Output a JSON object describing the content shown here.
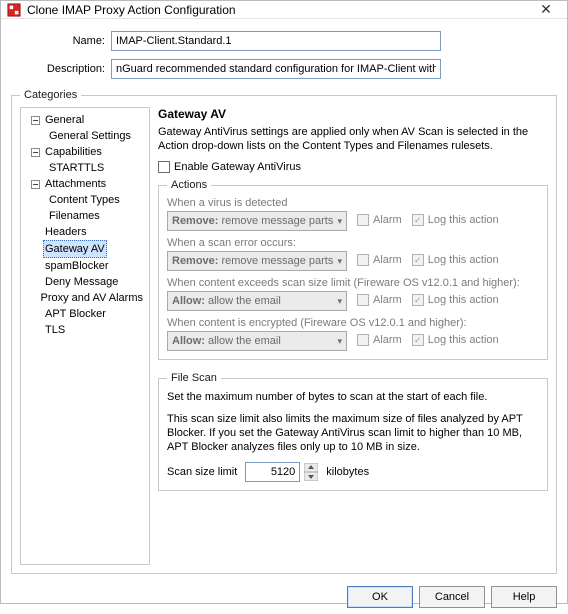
{
  "window": {
    "title": "Clone IMAP Proxy Action Configuration"
  },
  "form": {
    "name_label": "Name:",
    "name_value": "IMAP-Client.Standard.1",
    "desc_label": "Description:",
    "desc_value": "nGuard recommended standard configuration for IMAP-Client with logging enabled"
  },
  "categories": {
    "legend": "Categories",
    "tree": {
      "general": "General",
      "general_settings": "General Settings",
      "capabilities": "Capabilities",
      "starttls": "STARTTLS",
      "attachments": "Attachments",
      "content_types": "Content Types",
      "filenames": "Filenames",
      "headers": "Headers",
      "gateway_av": "Gateway AV",
      "spamblocker": "spamBlocker",
      "deny_message": "Deny Message",
      "proxy_av_alarms": "Proxy and AV Alarms",
      "apt_blocker": "APT Blocker",
      "tls": "TLS"
    }
  },
  "gateway": {
    "title": "Gateway AV",
    "description": "Gateway AntiVirus settings are applied only when AV Scan is selected in the Action drop-down lists on the Content Types and Filenames rulesets.",
    "enable_label": "Enable Gateway AntiVirus"
  },
  "actions": {
    "legend": "Actions",
    "alarm_label": "Alarm",
    "log_label": "Log this action",
    "rows": [
      {
        "label": "When a virus is detected",
        "combo_main": "Remove:",
        "combo_sub": "remove message parts"
      },
      {
        "label": "When a scan error occurs:",
        "combo_main": "Remove:",
        "combo_sub": "remove message parts"
      },
      {
        "label": "When content exceeds scan size limit (Fireware OS v12.0.1 and higher):",
        "combo_main": "Allow:",
        "combo_sub": "allow the email"
      },
      {
        "label": "When content is encrypted (Fireware OS v12.0.1 and higher):",
        "combo_main": "Allow:",
        "combo_sub": "allow the email"
      }
    ]
  },
  "filescan": {
    "legend": "File Scan",
    "line1": "Set the maximum number of bytes to scan at the start of each file.",
    "line2": "This scan size limit also limits the maximum size of files analyzed by APT Blocker. If you set the Gateway AntiVirus scan limit to higher than 10 MB, APT Blocker analyzes files only up to 10 MB in size.",
    "scan_label": "Scan size limit",
    "scan_value": "5120",
    "scan_unit": "kilobytes"
  },
  "buttons": {
    "ok": "OK",
    "cancel": "Cancel",
    "help": "Help"
  }
}
